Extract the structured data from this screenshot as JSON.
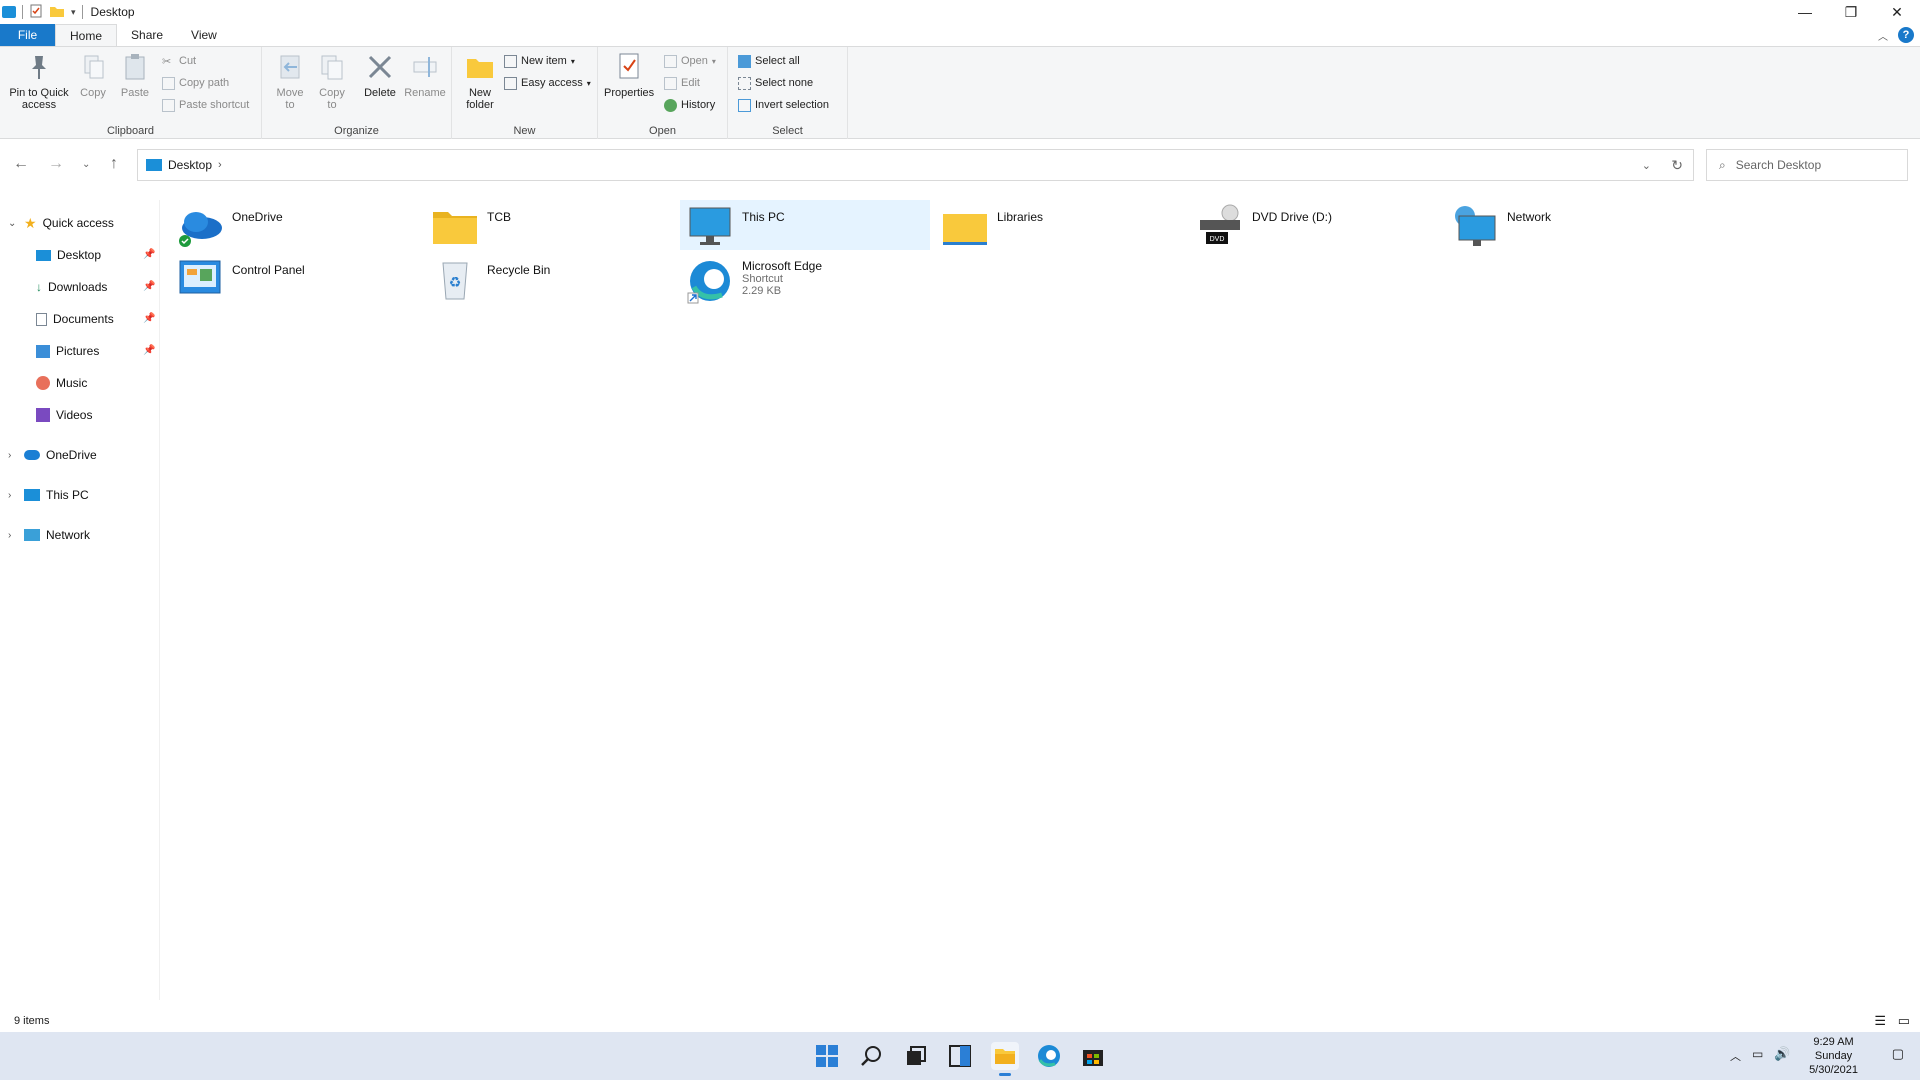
{
  "window": {
    "title": "Desktop"
  },
  "ribbon_tabs": [
    "File",
    "Home",
    "Share",
    "View"
  ],
  "ribbon": {
    "clipboard": {
      "label": "Clipboard",
      "pin": "Pin to Quick access",
      "copy": "Copy",
      "paste": "Paste",
      "cut": "Cut",
      "copy_path": "Copy path",
      "paste_shortcut": "Paste shortcut"
    },
    "organize": {
      "label": "Organize",
      "move_to": "Move to",
      "copy_to": "Copy to",
      "delete": "Delete",
      "rename": "Rename"
    },
    "new": {
      "label": "New",
      "new_folder": "New folder",
      "new_item": "New item",
      "easy_access": "Easy access"
    },
    "open": {
      "label": "Open",
      "properties": "Properties",
      "open": "Open",
      "edit": "Edit",
      "history": "History"
    },
    "select": {
      "label": "Select",
      "select_all": "Select all",
      "select_none": "Select none",
      "invert": "Invert selection"
    }
  },
  "address": {
    "path": "Desktop",
    "search_placeholder": "Search Desktop"
  },
  "nav": {
    "quick_access": "Quick access",
    "items": [
      "Desktop",
      "Downloads",
      "Documents",
      "Pictures",
      "Music",
      "Videos"
    ],
    "onedrive": "OneDrive",
    "this_pc": "This PC",
    "network": "Network"
  },
  "files": [
    {
      "name": "OneDrive",
      "icon": "onedrive-icon"
    },
    {
      "name": "TCB",
      "icon": "folder-icon"
    },
    {
      "name": "This PC",
      "icon": "monitor-icon"
    },
    {
      "name": "Libraries",
      "icon": "folder-icon"
    },
    {
      "name": "DVD Drive (D:)",
      "icon": "dvd-drive-icon"
    },
    {
      "name": "Network",
      "icon": "network-icon"
    },
    {
      "name": "Control Panel",
      "icon": "control-panel-icon"
    },
    {
      "name": "Recycle Bin",
      "icon": "recycle-bin-icon"
    },
    {
      "name": "Microsoft Edge",
      "icon": "edge-icon",
      "type": "Shortcut",
      "size": "2.29 KB"
    }
  ],
  "status": {
    "count": "9 items"
  },
  "taskbar": {
    "time": "9:29 AM",
    "day": "Sunday",
    "date": "5/30/2021"
  },
  "colors": {
    "accent": "#1979ca",
    "selection": "#e5f3ff",
    "taskbar": "#dfe6f2",
    "folder": "#f9c93c"
  }
}
